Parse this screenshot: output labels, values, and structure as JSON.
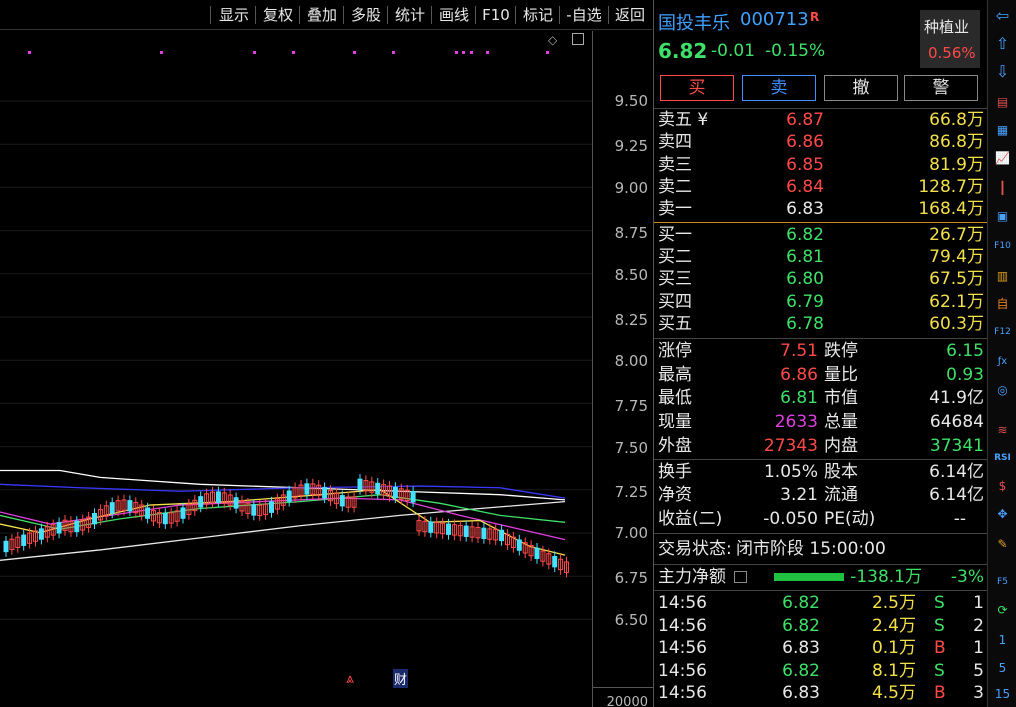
{
  "toolbar": {
    "items": [
      "显示",
      "复权",
      "叠加",
      "多股",
      "统计",
      "画线",
      "F10",
      "标记",
      "-自选",
      "返回"
    ]
  },
  "chart": {
    "y_ticks": [
      "9.50",
      "9.25",
      "9.00",
      "8.75",
      "8.50",
      "8.25",
      "8.00",
      "7.75",
      "7.50",
      "7.25",
      "7.00",
      "6.75",
      "6.50"
    ],
    "volume_tick": "20000",
    "events": {
      "up_arrow": "⩓",
      "cai": "财"
    }
  },
  "stock": {
    "name": "国投丰乐",
    "code": "000713",
    "flag": "R",
    "price": "6.82",
    "change": "-0.01",
    "change_pct": "-0.15%",
    "sector_name": "种植业",
    "sector_pct": "0.56%"
  },
  "actions": {
    "buy": "买",
    "sell": "卖",
    "cancel": "撤",
    "alert": "警"
  },
  "asks": [
    {
      "label": "卖五 ¥",
      "price": "6.87",
      "vol": "66.8万"
    },
    {
      "label": "卖四",
      "price": "6.86",
      "vol": "86.8万"
    },
    {
      "label": "卖三",
      "price": "6.85",
      "vol": "81.9万"
    },
    {
      "label": "卖二",
      "price": "6.84",
      "vol": "128.7万"
    },
    {
      "label": "卖一",
      "price": "6.83",
      "vol": "168.4万"
    }
  ],
  "bids": [
    {
      "label": "买一",
      "price": "6.82",
      "vol": "26.7万"
    },
    {
      "label": "买二",
      "price": "6.81",
      "vol": "79.4万"
    },
    {
      "label": "买三",
      "price": "6.80",
      "vol": "67.5万"
    },
    {
      "label": "买四",
      "price": "6.79",
      "vol": "62.1万"
    },
    {
      "label": "买五",
      "price": "6.78",
      "vol": "60.3万"
    }
  ],
  "stats": {
    "limit_up_label": "涨停",
    "limit_up": "7.51",
    "limit_down_label": "跌停",
    "limit_down": "6.15",
    "high_label": "最高",
    "high": "6.86",
    "vol_ratio_label": "量比",
    "vol_ratio": "0.93",
    "low_label": "最低",
    "low": "6.81",
    "mkt_cap_label": "市值",
    "mkt_cap": "41.9亿",
    "cur_vol_label": "现量",
    "cur_vol": "2633",
    "total_vol_label": "总量",
    "total_vol": "64684",
    "outer_label": "外盘",
    "outer": "27343",
    "inner_label": "内盘",
    "inner": "37341",
    "turnover_label": "换手",
    "turnover": "1.05%",
    "equity_label": "股本",
    "equity": "6.14亿",
    "nav_label": "净资",
    "nav": "3.21",
    "float_label": "流通",
    "float": "6.14亿",
    "eps_label": "收益(二)",
    "eps": "-0.050",
    "pe_label": "PE(动)",
    "pe": "--"
  },
  "status": {
    "label": "交易状态:",
    "value": "闭市阶段 15:00:00"
  },
  "capital": {
    "label": "主力净额",
    "amount": "-138.1万",
    "pct": "-3%"
  },
  "ticks": [
    {
      "time": "14:56",
      "price": "6.82",
      "vol": "2.5万",
      "side": "S",
      "n": "1"
    },
    {
      "time": "14:56",
      "price": "6.82",
      "vol": "2.4万",
      "side": "S",
      "n": "2"
    },
    {
      "time": "14:56",
      "price": "6.83",
      "vol": "0.1万",
      "side": "B",
      "n": "1"
    },
    {
      "time": "14:56",
      "price": "6.82",
      "vol": "8.1万",
      "side": "S",
      "n": "5"
    },
    {
      "time": "14:56",
      "price": "6.83",
      "vol": "4.5万",
      "side": "B",
      "n": "3"
    }
  ],
  "sidebar": {
    "icons": [
      "back-icon",
      "up-icon",
      "down-icon",
      "report-icon",
      "grid-icon",
      "trend-icon",
      "kline-icon",
      "news-icon",
      "f10-icon",
      "info-icon",
      "self-icon",
      "f12-icon",
      "fx-icon",
      "circle-icon",
      "wave-icon",
      "rsi-icon",
      "dollar-icon",
      "move-icon",
      "pen-icon",
      "f5-icon",
      "refresh-icon"
    ],
    "labels": [
      "RSI",
      "1",
      "5",
      "15"
    ]
  },
  "colors": {
    "up": "#ff4a4a",
    "down": "#3fe06a",
    "ma_white": "#e8e8e8",
    "ma_yellow": "#f2e04a",
    "ma_magenta": "#e040e0",
    "ma_green": "#3fe06a",
    "ma_blue": "#3a3aff"
  }
}
